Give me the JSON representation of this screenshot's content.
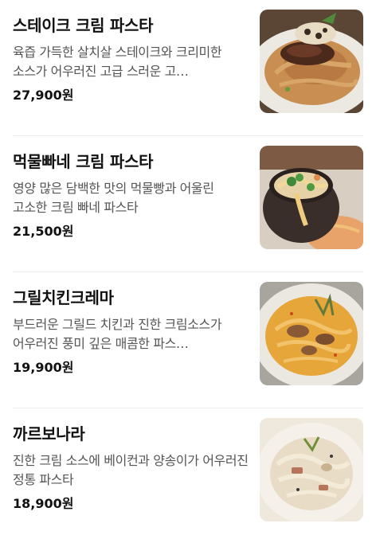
{
  "menu": {
    "items": [
      {
        "name": "스테이크 크림 파스타",
        "description": "육즙 가득한 살치살 스테이크와 크리미한 소스가 어우러진 고급 스러운 고…",
        "price": "27,900원",
        "image_icon": "steak-cream-pasta-photo"
      },
      {
        "name": "먹물빠네 크림 파스타",
        "description": "영양 많은 담백한 맛의 먹물빵과 어울린 고소한 크림 빠네 파스타",
        "price": "21,500원",
        "image_icon": "squid-ink-bread-pasta-photo"
      },
      {
        "name": "그릴치킨크레마",
        "description": "부드러운 그릴드 치킨과 진한 크림소스가 어우러진 풍미 깊은 매콤한 파스…",
        "price": "19,900원",
        "image_icon": "grilled-chicken-crema-photo"
      },
      {
        "name": "까르보나라",
        "description": "진한 크림 소스에 베이컨과 양송이가 어우러진 정통 파스타",
        "price": "18,900원",
        "image_icon": "carbonara-photo"
      }
    ]
  }
}
